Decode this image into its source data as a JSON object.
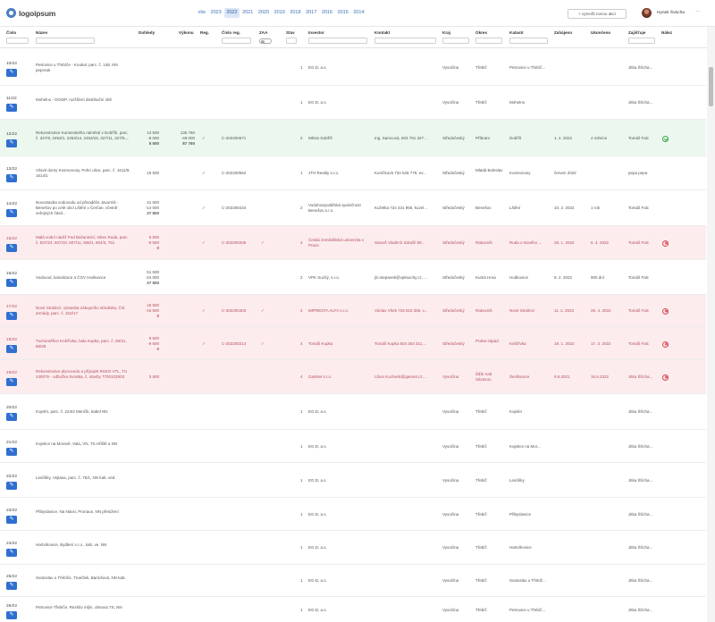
{
  "brand": {
    "logo_text": "logoipsum"
  },
  "years": [
    "vše",
    "2023",
    "2022",
    "2021",
    "2020",
    "2019",
    "2018",
    "2017",
    "2016",
    "2015",
    "2014"
  ],
  "active_year": "2022",
  "header": {
    "new_action": "+ vytvořit novou akci",
    "user_name": "Hynek Švácha",
    "more": "···"
  },
  "columns": {
    "cislo": "Číslo",
    "nazev": "Název",
    "dohledy": "Dohledy",
    "vykonu": "Výkonu",
    "reg": "Reg.",
    "cislo_reg": "Číslo reg.",
    "zaa": "ZAA",
    "stav": "Stav",
    "investor": "Investor",
    "kontakt": "Kontakt",
    "kraj": "Kraj",
    "okres": "Okres",
    "katastr": "Katastr",
    "zahajeno": "Zahájeno",
    "ukonceno": "Ukončeno",
    "zajistuje": "Zajišťuje",
    "nalez": "Nález"
  },
  "rows": [
    {
      "num": "10/22",
      "style": "",
      "nazev": "Petrovice u Třebíče - Koukal, parc. č. 148, NN pepnrak",
      "dohledy": [],
      "vykonu": [],
      "reg": "",
      "cislo_reg": "",
      "zaa": "",
      "stav": "1",
      "investor": "EG.D, a.s.",
      "kontakt": "",
      "kraj": "Vysočina",
      "okres": "Třebíč",
      "katastr": "Petrovice u Třebíč...",
      "zahajeno": "",
      "ukonceno": "",
      "zajistuje": "Jitka Šťicha...",
      "nalez": ""
    },
    {
      "num": "11/22",
      "style": "",
      "nazev": "Mohelno - DOSIP, rozšíření distribuční sítě",
      "dohledy": [],
      "vykonu": [],
      "reg": "",
      "cislo_reg": "",
      "zaa": "",
      "stav": "1",
      "investor": "EG.D, a.s.",
      "kontakt": "",
      "kraj": "Vysočina",
      "okres": "Třebíč",
      "katastr": "Mohelno",
      "zahajeno": "",
      "ukonceno": "",
      "zajistuje": "Jitka Šťicha...",
      "nalez": ""
    },
    {
      "num": "12/22",
      "style": "green",
      "nazev": "Rekonstrukce Komenského náměstí v Dobříši, parc. č. 327/8, 2453/1, 2453/14, 2453/15, 327/11, 327/5,...",
      "dohledy": [
        "13 500",
        "-8 000",
        "5 500"
      ],
      "vykonu": [
        "135 760",
        "-48 000",
        "87 760"
      ],
      "reg": "✓",
      "cislo_reg": "C-202200671",
      "zaa": "",
      "stav": "2",
      "investor": "Město Dobříš",
      "kontakt": "Ing. Samcová, 603 701 327...",
      "kraj": "Středočeský",
      "okres": "Příbram",
      "katastr": "Dobříš",
      "zahajeno": "1. 4. 2022",
      "ukonceno": "4 měsíce",
      "zajistuje": "Tomáš Falc",
      "nalez": "ok"
    },
    {
      "num": "13/22",
      "style": "",
      "nazev": "Vilové domy Kosmonosy, Pohri ulice, parc. č. 1611/9, 1614/1",
      "dohledy": [
        "15 500"
      ],
      "vykonu": [],
      "reg": "✓",
      "cislo_reg": "C-202200552",
      "zaa": "",
      "stav": "1",
      "investor": "JTH Reality s.r.o.",
      "kontakt": "Koníčková 734 528 779, ev...",
      "kraj": "Středočeský",
      "okres": "Mladá Boleslav",
      "katastr": "Kosmonosy",
      "zahajeno": "červen 2022",
      "ukonceno": "",
      "zajistuje": "pepa pepa",
      "nalez": ""
    },
    {
      "num": "14/22",
      "style": "",
      "nazev": "Novostavba vodovodu od přivaděče Javorník - Benešov po celé obci Lštění v Čerčan, včetně veřejných částí...",
      "dohledy": [
        "41 500",
        "-14 000",
        "27 500"
      ],
      "vykonu": [],
      "reg": "✓",
      "cislo_reg": "C-202200434",
      "zaa": "",
      "stav": "2",
      "investor": "Vodohospodářská společnost Benešov s.r.o.",
      "kontakt": "Kuželka 724 431 956, kuzel...",
      "kraj": "Středočeský",
      "okres": "Benešov",
      "katastr": "Lštění",
      "zahajeno": "10. 2. 2022",
      "ukonceno": "1 rok",
      "zajistuje": "Tomáš Falc",
      "nalez": ""
    },
    {
      "num": "15/22",
      "style": "red",
      "nazev": "Malá vodní nádrž Pod Bažantnicí, Obec Ruda, parc. č. 507/24, 507/10, 507/11, 606/1, 504/3, 751",
      "dohledy": [
        "9 500",
        "-9 500",
        "0"
      ],
      "vykonu": [],
      "reg": "✓",
      "cislo_reg": "C-202200205",
      "zaa": "✓",
      "stav": "4",
      "investor": "Česká zemědělská univerzita v Praze",
      "kontakt": "Stavoš Vladimír Zdražil 80...",
      "kraj": "Středočeský",
      "okres": "Rakovník",
      "katastr": "Ruda u Nového ...",
      "zahajeno": "28. 1. 2022",
      "ukonceno": "6. 4. 2022",
      "zajistuje": "Tomáš Falc",
      "nalez": "err"
    },
    {
      "num": "16/22",
      "style": "",
      "nazev": "Vodovod, kanalizace a ČOV Hodkovice",
      "dohledy": [
        "51 500",
        "-24 000",
        "27 500"
      ],
      "vykonu": [],
      "reg": "",
      "cislo_reg": "",
      "zaa": "",
      "stav": "2",
      "investor": "VPK Suchý, s.r.o.",
      "kontakt": "jiri.stepanek@vpksuchy.cz, ...",
      "kraj": "Středočeský",
      "okres": "Kutná Hora",
      "katastr": "Hodkovice",
      "zahajeno": "9. 2. 2022",
      "ukonceno": "900 dní",
      "zajistuje": "Tomáš Falc",
      "nalez": ""
    },
    {
      "num": "17/22",
      "style": "red",
      "nazev": "Nové Strašecí, výstavba nákupního střediska, Čsl. armády, parc. č. 310/17",
      "dohledy": [
        "15 500",
        "-15 500",
        "0"
      ],
      "vykonu": [],
      "reg": "✓",
      "cislo_reg": "C-202200403",
      "zaa": "✓",
      "stav": "4",
      "investor": "IMPRESTA ALFA s.r.o.",
      "kontakt": "Václav Vítek 725 815 355, v...",
      "kraj": "Středočeský",
      "okres": "Rakovník",
      "katastr": "Nové Strašecí",
      "zahajeno": "11. 2. 2022",
      "ukonceno": "26. 4. 2022",
      "zajistuje": "Tomáš Falc",
      "nalez": "err"
    },
    {
      "num": "18/22",
      "style": "red",
      "nazev": "Tuchoměřice Kněžívka, hala Kupka, parc. č. 86/31, 86/29",
      "dohledy": [
        "9 500",
        "-9 500",
        "0"
      ],
      "vykonu": [],
      "reg": "✓",
      "cislo_reg": "C-202200214",
      "zaa": "✓",
      "stav": "4",
      "investor": "Tomáš Kupka",
      "kontakt": "Tomáš Kupka 604 263 311,...",
      "kraj": "Středočeský",
      "okres": "Praha-západ",
      "katastr": "Kněžívka",
      "zahajeno": "19. 1. 2022",
      "ukonceno": "17. 3. 2022",
      "zajistuje": "Tomáš Falc",
      "nalez": "err"
    },
    {
      "num": "19/22",
      "style": "red",
      "nazev": "Rekonstrukce plynovodu a přípojek RSKO VTL, TU 240076 - odbočka Svratka, č. stavby 7700102903",
      "dohledy": [
        "3 500"
      ],
      "vykonu": [],
      "reg": "",
      "cislo_reg": "",
      "zaa": "",
      "stav": "4",
      "investor": "GasNet s.r.o.",
      "kontakt": "Libon Kucherik@gasnet.cz, ...",
      "kraj": "Vysočina",
      "okres": "Žďár nad Sázavou",
      "katastr": "Šerdkovice",
      "zahajeno": "9.5.2021",
      "ukonceno": "16.5.2022",
      "zajistuje": "Jitka Šťicha...",
      "nalez": "err"
    },
    {
      "num": "20/22",
      "style": "",
      "nazev": "Kojetín, parc. č. 224/4 Menčík, kabel NN",
      "dohledy": [],
      "vykonu": [],
      "reg": "",
      "cislo_reg": "",
      "zaa": "",
      "stav": "1",
      "investor": "EG.D, a.s.",
      "kontakt": "",
      "kraj": "Vysočina",
      "okres": "Třebíč",
      "katastr": "Kojetín",
      "zahajeno": "",
      "ukonceno": "",
      "zajistuje": "Jitka Šťicha...",
      "nalez": ""
    },
    {
      "num": "21/22",
      "style": "",
      "nazev": "Kojetice na Moravě, Vala, VN, TS Hřiště a NN",
      "dohledy": [],
      "vykonu": [],
      "reg": "",
      "cislo_reg": "",
      "zaa": "",
      "stav": "1",
      "investor": "EG.D, a.s.",
      "kontakt": "",
      "kraj": "Vysočina",
      "okres": "Třebíč",
      "katastr": "Kojetice na Mor...",
      "zahajeno": "",
      "ukonceno": "",
      "zajistuje": "Jitka Šťicha...",
      "nalez": ""
    },
    {
      "num": "22/22",
      "style": "",
      "nazev": "Lesůňky, Vejtasa, parc. č. 76/1, NN kab. ved.",
      "dohledy": [],
      "vykonu": [],
      "reg": "",
      "cislo_reg": "",
      "zaa": "",
      "stav": "1",
      "investor": "EG.D, a.s.",
      "kontakt": "",
      "kraj": "Vysočina",
      "okres": "Třebíč",
      "katastr": "Lesůňky",
      "zahajeno": "",
      "ukonceno": "",
      "zajistuje": "Jitka Šťicha...",
      "nalez": ""
    },
    {
      "num": "23/22",
      "style": "",
      "nazev": "Přibyslavice, Na Návsi, Pronaus, NN přeložení",
      "dohledy": [],
      "vykonu": [],
      "reg": "",
      "cislo_reg": "",
      "zaa": "",
      "stav": "1",
      "investor": "EG.D, a.s.",
      "kontakt": "",
      "kraj": "Vysočina",
      "okres": "Třebíč",
      "katastr": "Přibyslavice",
      "zahajeno": "",
      "ukonceno": "",
      "zajistuje": "Jitka Šťicha...",
      "nalez": ""
    },
    {
      "num": "24/22",
      "style": "",
      "nazev": "Hartvíkovice, Bydlení s.r.o., kab. ve. NN",
      "dohledy": [],
      "vykonu": [],
      "reg": "",
      "cislo_reg": "",
      "zaa": "",
      "stav": "1",
      "investor": "EG.D, a.s.",
      "kontakt": "",
      "kraj": "Vysočina",
      "okres": "Třebíč",
      "katastr": "Hartvíkovice",
      "zahajeno": "",
      "ukonceno": "",
      "zajistuje": "Jitka Šťicha...",
      "nalez": ""
    },
    {
      "num": "25/22",
      "style": "",
      "nazev": "Svatoslav u Třebíče, Truečlek, Bartošová, NN kab.",
      "dohledy": [],
      "vykonu": [],
      "reg": "",
      "cislo_reg": "",
      "zaa": "",
      "stav": "1",
      "investor": "EG.D, a.s.",
      "kontakt": "",
      "kraj": "Vysočina",
      "okres": "Třebíč",
      "katastr": "Svatoslav u Třebíč...",
      "zahajeno": "",
      "ukonceno": "",
      "zajistuje": "Jitka Šťicha...",
      "nalez": ""
    },
    {
      "num": "26/22",
      "style": "",
      "nazev": "Petrovice Třebíče, Rezkův mlýn, obnova TS, NN",
      "dohledy": [],
      "vykonu": [],
      "reg": "",
      "cislo_reg": "",
      "zaa": "",
      "stav": "1",
      "investor": "EG.D, a.s.",
      "kontakt": "",
      "kraj": "Vysočina",
      "okres": "Třebíč",
      "katastr": "Petrovice u Třebíč...",
      "zahajeno": "",
      "ukonceno": "",
      "zajistuje": "Jitka Šťicha...",
      "nalez": ""
    }
  ]
}
